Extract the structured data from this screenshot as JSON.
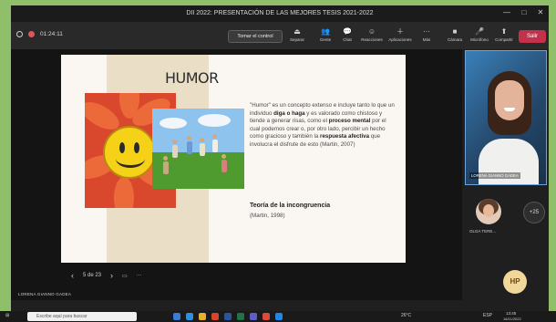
{
  "window": {
    "title": "DII 2022: PRESENTACIÓN DE LAS MEJORES TESIS 2021-2022",
    "controls": [
      "—",
      "□",
      "✕"
    ]
  },
  "meeting": {
    "timer": "01:24:11",
    "take_control": "Tomar el control",
    "buttons": [
      {
        "icon": "eject-icon",
        "glyph": "⏏",
        "label": "Separar"
      },
      {
        "icon": "people-icon",
        "glyph": "👥",
        "label": "Gente"
      },
      {
        "icon": "chat-icon",
        "glyph": "💬",
        "label": "Chat"
      },
      {
        "icon": "reactions-icon",
        "glyph": "☺",
        "label": "Reacciones"
      },
      {
        "icon": "apps-icon",
        "glyph": "＋",
        "label": "Aplicaciones"
      },
      {
        "icon": "more-icon",
        "glyph": "···",
        "label": "Más"
      },
      {
        "icon": "camera-icon",
        "glyph": "■",
        "label": "Cámara"
      },
      {
        "icon": "mic-off-icon",
        "glyph": "🎤",
        "label": "Micrófono"
      },
      {
        "icon": "share-icon",
        "glyph": "⬆",
        "label": "Compartir"
      }
    ],
    "leave": "Salir"
  },
  "slide": {
    "title": "HUMOR",
    "paragraph_parts": [
      {
        "text": "\"Humor\" es un concepto extenso e incluye tanto lo que un individuo ",
        "bold": false
      },
      {
        "text": "diga o haga",
        "bold": true
      },
      {
        "text": " y es valorado como chistoso y tiende a generar risas, como el ",
        "bold": false
      },
      {
        "text": "proceso mental",
        "bold": true
      },
      {
        "text": " por el cual podemos crear o, por otro lado, percibir un hecho como gracioso y también la ",
        "bold": false
      },
      {
        "text": "respuesta afectiva",
        "bold": true
      },
      {
        "text": " que involucra el disfrute de esto (Martin, 2007)",
        "bold": false
      }
    ],
    "subtitle": "Teoría de la incongruencia",
    "citation": "(Martin, 1998)"
  },
  "navigation": {
    "prev": "‹",
    "page": "5 de 23",
    "next": "›"
  },
  "presenter_name": "LORENA GIANNO GADEA",
  "participants": {
    "main_name": "LORENA GIANNO GADEA",
    "small_name": "OLGA TERE...",
    "more_count": "+25",
    "initials": "HP"
  },
  "taskbar": {
    "search_placeholder": "Escribe aquí para buscar",
    "weather": "26°C",
    "lang": "ESP",
    "time": "13:45",
    "date": "16/11/2022"
  },
  "colors": {
    "leave": "#c4314b",
    "accent_border": "#6da3d8",
    "slide_beige": "#eadfc6"
  }
}
